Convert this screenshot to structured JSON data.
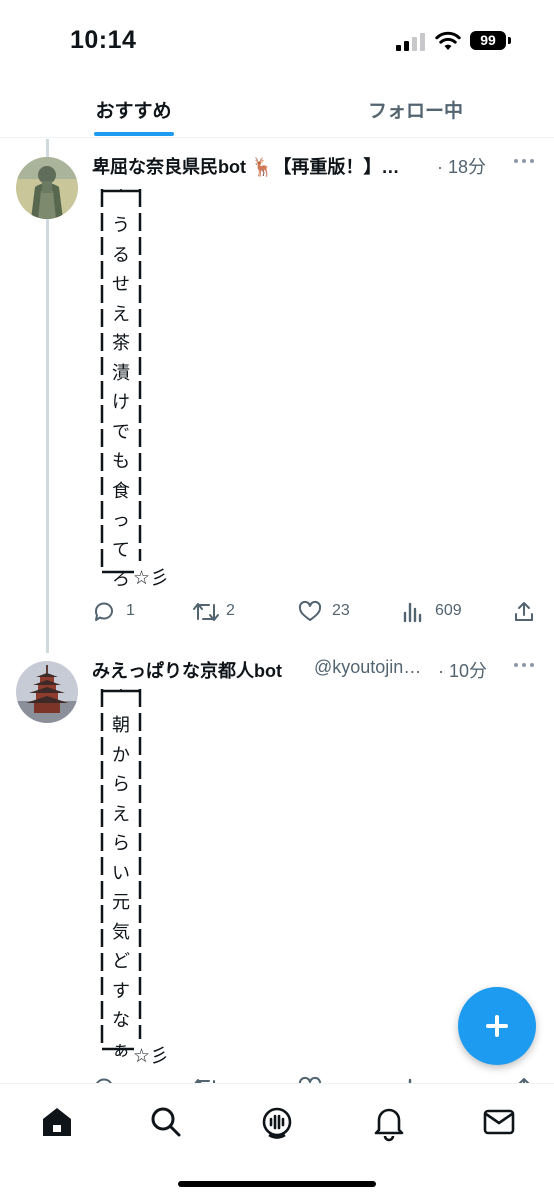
{
  "status_bar": {
    "time": "10:14",
    "battery": "99"
  },
  "tabs": [
    {
      "label": "おすすめ",
      "selected": true
    },
    {
      "label": "フォロー中",
      "selected": false
    }
  ],
  "tweets": [
    {
      "author": "卑屈な奈良県民bot 🦌【再重版！】…",
      "handle": "",
      "time": "· 18分",
      "vertical_text": "うるせえ茶漬けでも食ってろ",
      "signature": "☆彡",
      "replies": "1",
      "retweets": "2",
      "likes": "23",
      "views": "609"
    },
    {
      "author": "みえっぱりな京都人bot",
      "handle": "@kyoutojin…",
      "time": "· 10分",
      "vertical_text": "朝からえらい元気どすなぁ",
      "signature": "☆彡",
      "replies": "",
      "retweets": "",
      "likes": "",
      "views": ""
    }
  ],
  "bottom_nav": [
    "home-icon",
    "search-icon",
    "spaces-icon",
    "bell-icon",
    "mail-icon"
  ],
  "colors": {
    "accent": "#1d9bf0",
    "text_primary": "#0f1419",
    "text_secondary": "#536471",
    "divider": "#eff3f4",
    "thread_line": "#cfd9de"
  }
}
